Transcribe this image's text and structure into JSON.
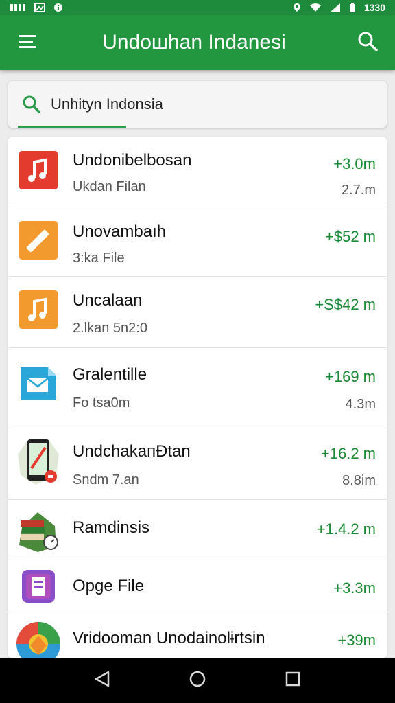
{
  "status_bar": {
    "left_icons": [
      "network-icon",
      "image-icon",
      "info-icon"
    ],
    "right_icons": [
      "location-icon",
      "wifi-icon",
      "signal-icon",
      "battery-icon"
    ],
    "battery_text": "1330"
  },
  "app_bar": {
    "title": "Undoшhan Indanesi",
    "menu_icon": "menu-icon",
    "search_icon": "search-icon"
  },
  "search": {
    "value": "Unhityn Indonsia",
    "icon": "search-icon",
    "accent": "#2a9c4a"
  },
  "files": [
    {
      "name": "Undonibelbosan",
      "sub": "Ukdan Filan",
      "size": "+3.0m",
      "meta": "2.7.m",
      "icon": "music-file-icon",
      "color": "#e33b2e"
    },
    {
      "name": "Unovambaıh",
      "sub": "3:ka File",
      "size": "+$52 m",
      "meta": "",
      "icon": "edit-file-icon",
      "color": "#f29a2e"
    },
    {
      "name": "Uncalaan",
      "sub": "2.lkan 5n2:0",
      "size": "+S$42 m",
      "meta": "",
      "icon": "music-file-icon",
      "color": "#f29a2e"
    },
    {
      "name": "Gralentille",
      "sub": "Fo tsa0m",
      "size": "+169 m",
      "meta": "4.3m",
      "icon": "mail-file-icon",
      "color": "#2aa7d8"
    },
    {
      "name": "UndchakaпƉtan",
      "sub": "Sndm 7.an",
      "size": "+16.2 m",
      "meta": "8.8im",
      "icon": "phone-app-icon",
      "color": "#3b8f4a"
    },
    {
      "name": "Ramdinsis",
      "sub": "",
      "size": "+1.4.2 m",
      "meta": "",
      "icon": "books-icon",
      "color": "#3a7a3a"
    },
    {
      "name": "Opge File",
      "sub": "",
      "size": "+3.3m",
      "meta": "",
      "icon": "document-icon",
      "color": "#8a4fc8"
    },
    {
      "name": "Vridooman Unodainolɨrtsin",
      "sub": "",
      "size": "+39m",
      "meta": "",
      "icon": "chrome-like-icon",
      "color": "#e0a020"
    }
  ],
  "nav_bar": {
    "buttons": [
      "back-icon",
      "home-icon",
      "recents-icon"
    ]
  },
  "colors": {
    "primary": "#23973f",
    "primary_dark": "#1e8a3c",
    "size_text": "#1a8a34"
  }
}
